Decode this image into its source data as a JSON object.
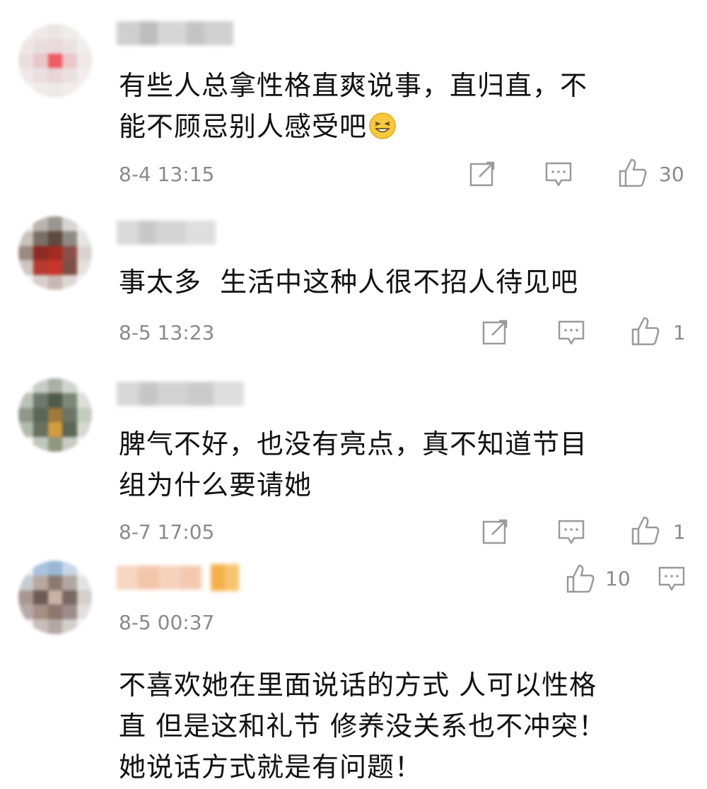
{
  "comments": [
    {
      "text_lines": [
        "有些人总拿性格直爽说事，直归直，不",
        "能不顾忌别人感受吧"
      ],
      "emoji": "grinning-face-emoji",
      "time": "8-4 13:15",
      "likes": "30"
    },
    {
      "text_lines": [
        "事太多  生活中这种人很不招人待见吧"
      ],
      "time": "8-5 13:23",
      "likes": "1"
    },
    {
      "text_lines": [
        "脾气不好，也没有亮点，真不知道节目",
        "组为什么要请她"
      ],
      "time": "8-7 17:05",
      "likes": "1"
    },
    {
      "text_lines": [
        "不喜欢她在里面说话的方式 人可以性格",
        "直 但是这和礼节 修养没关系也不冲突！",
        "她说话方式就是有问题！"
      ],
      "time": "8-5 00:37",
      "likes": "10"
    }
  ],
  "icons": {
    "share": "share-icon",
    "comment": "comment-icon",
    "like": "thumbs-up-icon"
  },
  "colors": {
    "text": "#111111",
    "meta": "#8a8a8a",
    "icon": "#9a9a9a"
  }
}
